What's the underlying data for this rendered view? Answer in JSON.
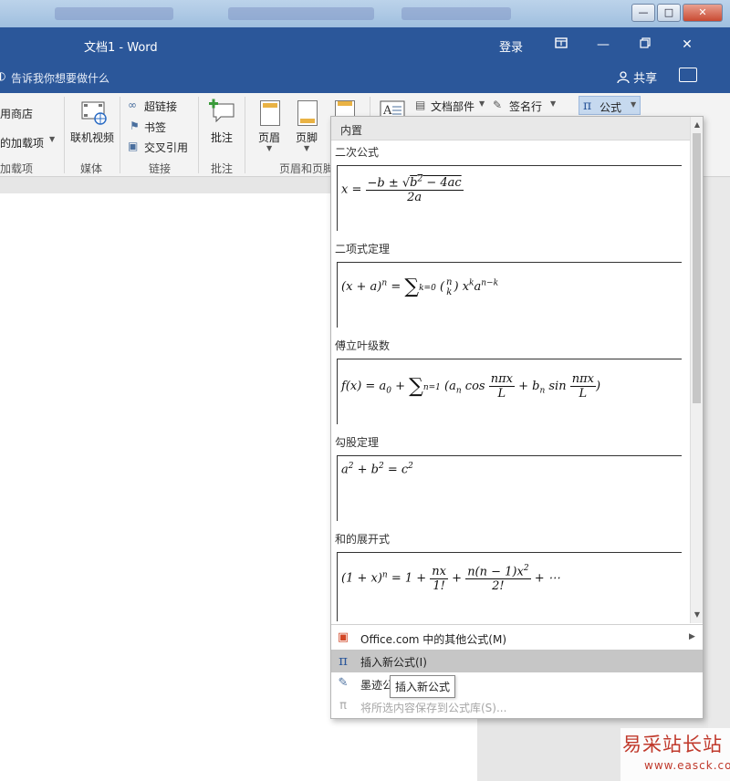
{
  "window": {
    "doc_title": "文档1  -  Word",
    "login": "登录",
    "tell_me": "告诉我你想要做什么",
    "share": "共享"
  },
  "ribbon": {
    "store": "用商店",
    "my_addins": "的加载项",
    "addins_group": "加载项",
    "online_video": "联机视频",
    "media_group": "媒体",
    "hyperlink": "超链接",
    "bookmark": "书签",
    "cross_ref": "交叉引用",
    "links_group": "链接",
    "comment": "批注",
    "comments_group": "批注",
    "header": "页眉",
    "footer": "页脚",
    "header_footer_group": "页眉和页脚",
    "doc_parts": "文档部件",
    "signature": "签名行",
    "equation": "公式"
  },
  "gallery": {
    "header": "内置",
    "sections": [
      {
        "title": "二次公式"
      },
      {
        "title": "二项式定理"
      },
      {
        "title": "傅立叶级数"
      },
      {
        "title": "勾股定理"
      },
      {
        "title": "和的展开式"
      }
    ],
    "menu": [
      {
        "label": "Office.com 中的其他公式(M)",
        "icon": "office-icon",
        "has_submenu": true
      },
      {
        "label": "插入新公式(I)",
        "icon": "pi-icon",
        "hover": true
      },
      {
        "label": "墨迹公",
        "icon": "ink-icon"
      },
      {
        "label": "将所选内容保存到公式库(S)...",
        "icon": "save-gallery-icon",
        "disabled": true
      }
    ],
    "tooltip": "插入新公式"
  },
  "watermark": {
    "main": "易采站长站",
    "sub": "www.easck.com"
  }
}
